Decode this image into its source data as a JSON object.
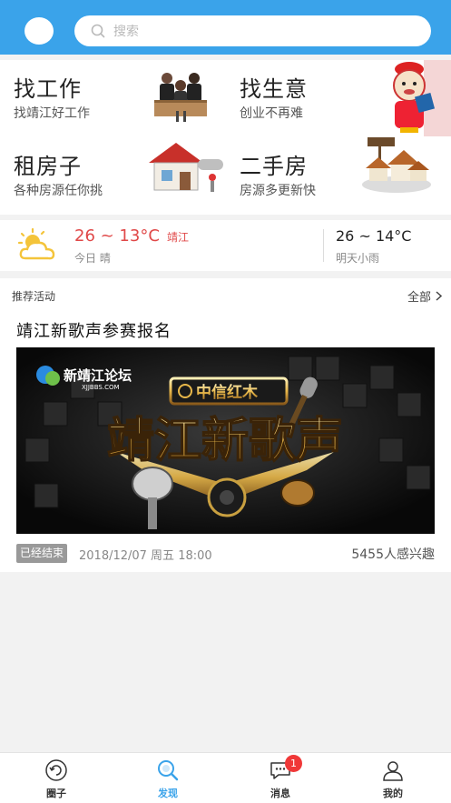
{
  "header": {
    "search_placeholder": "搜索"
  },
  "services": [
    {
      "title": "找工作",
      "subtitle": "找靖江好工作",
      "icon": "office-desk-people-icon"
    },
    {
      "title": "找生意",
      "subtitle": "创业不再难",
      "icon": "lucky-cat-mascot-icon"
    },
    {
      "title": "租房子",
      "subtitle": "各种房源任你挑",
      "icon": "house-key-icon"
    },
    {
      "title": "二手房",
      "subtitle": "房源多更新快",
      "icon": "houses-for-sale-icon"
    }
  ],
  "weather": {
    "today_temp": "26 ~ 13°C",
    "city": "靖江",
    "today_desc": "今日 晴",
    "tomorrow_temp": "26 ~ 14°C",
    "tomorrow_desc": "明天小雨"
  },
  "recommended": {
    "section_label": "推荐活动",
    "all_label": "全部",
    "event": {
      "title": "靖江新歌声参赛报名",
      "banner": {
        "logo_text": "新靖江论坛",
        "logo_url_text": "XJJBBS.COM",
        "sponsor_text": "中信红木",
        "headline": "靖江新歌声"
      },
      "status": "已经结束",
      "datetime": "2018/12/07 周五 18:00",
      "interest": "5455人感兴趣"
    }
  },
  "tabbar": {
    "tabs": [
      {
        "label": "圈子",
        "icon": "circle-refresh-icon",
        "active": false
      },
      {
        "label": "发现",
        "icon": "discover-search-icon",
        "active": true
      },
      {
        "label": "消息",
        "icon": "message-bubble-icon",
        "active": false,
        "badge": "1"
      },
      {
        "label": "我的",
        "icon": "user-profile-icon",
        "active": false
      }
    ]
  },
  "colors": {
    "brand_blue": "#3aa3ea",
    "temp_red": "#e04848",
    "badge_red": "#f03838"
  }
}
